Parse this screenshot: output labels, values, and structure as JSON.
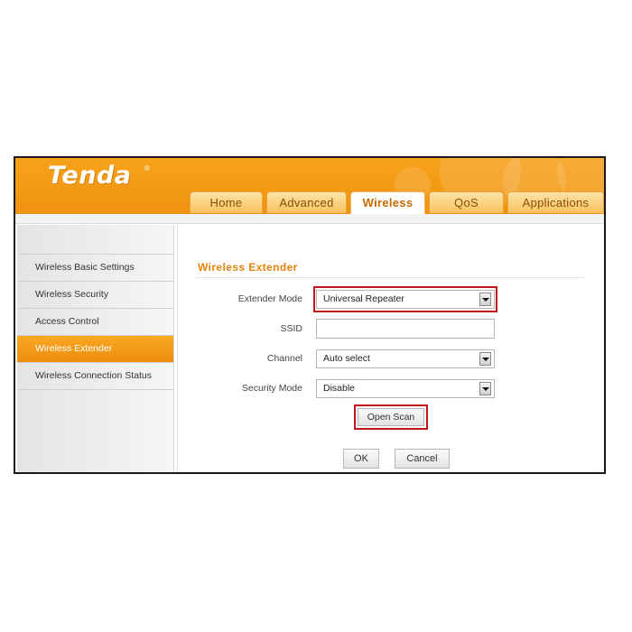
{
  "header": {
    "logo_text": "Tenda",
    "logo_mark": "®",
    "colors": {
      "brand_orange": "#f39a14",
      "accent_text": "#e8830a",
      "highlight_red": "#c0161c"
    },
    "tabs": [
      {
        "label": "Home",
        "active": false
      },
      {
        "label": "Advanced",
        "active": false
      },
      {
        "label": "Wireless",
        "active": true
      },
      {
        "label": "QoS",
        "active": false
      },
      {
        "label": "Applications",
        "active": false
      }
    ]
  },
  "sidebar": {
    "items": [
      {
        "label": "Wireless Basic Settings",
        "active": false
      },
      {
        "label": "Wireless Security",
        "active": false
      },
      {
        "label": "Access Control",
        "active": false
      },
      {
        "label": "Wireless Extender",
        "active": true
      },
      {
        "label": "Wireless Connection Status",
        "active": false
      }
    ]
  },
  "main": {
    "title": "Wireless Extender",
    "fields": {
      "extender_mode": {
        "label": "Extender Mode",
        "value": "Universal Repeater",
        "highlighted": true
      },
      "ssid": {
        "label": "SSID",
        "value": ""
      },
      "channel": {
        "label": "Channel",
        "value": "Auto select"
      },
      "security_mode": {
        "label": "Security Mode",
        "value": "Disable"
      }
    },
    "open_scan_label": "Open Scan",
    "ok_label": "OK",
    "cancel_label": "Cancel"
  },
  "icons": [
    "dropdown-arrow-icon"
  ]
}
